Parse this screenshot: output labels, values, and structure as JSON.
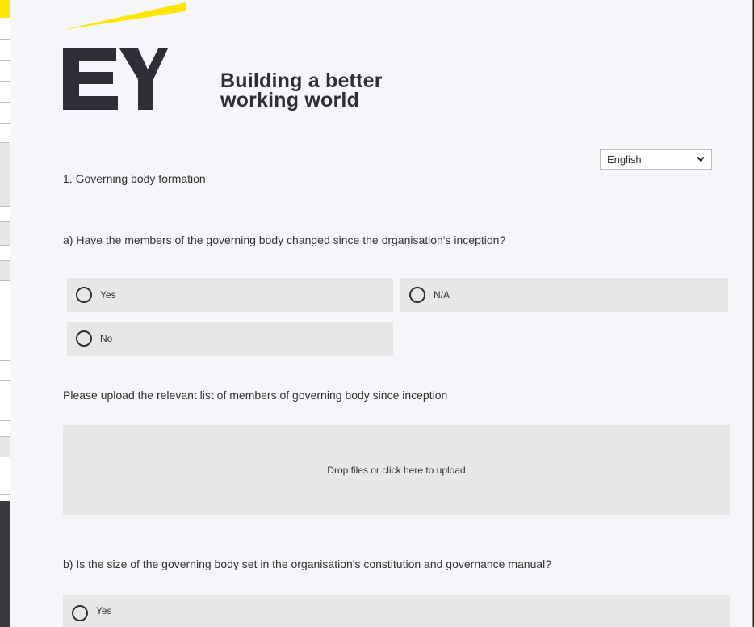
{
  "brand": {
    "logo_mark": "EY",
    "tagline_line1": "Building a better",
    "tagline_line2": "working world",
    "accent_color": "#ffe600",
    "dark_color": "#2e2e38"
  },
  "language_select": {
    "selected": "English",
    "icon": "chevron-down-icon"
  },
  "section": {
    "title": "1. Governing body formation"
  },
  "question_a": {
    "text": "a) Have the members of the governing body changed since the organisation's inception?",
    "options": [
      {
        "label": "Yes",
        "selected": false
      },
      {
        "label": "N/A",
        "selected": false
      },
      {
        "label": "No",
        "selected": false
      }
    ]
  },
  "upload": {
    "prompt": "Please upload the relevant list of members of governing body since inception",
    "dropzone_label": "Drop files or click here to upload"
  },
  "question_b": {
    "text": "b) Is the size of the governing body set in the organisation's constitution and  governance manual?",
    "options": [
      {
        "label": "Yes",
        "selected": false
      }
    ]
  }
}
